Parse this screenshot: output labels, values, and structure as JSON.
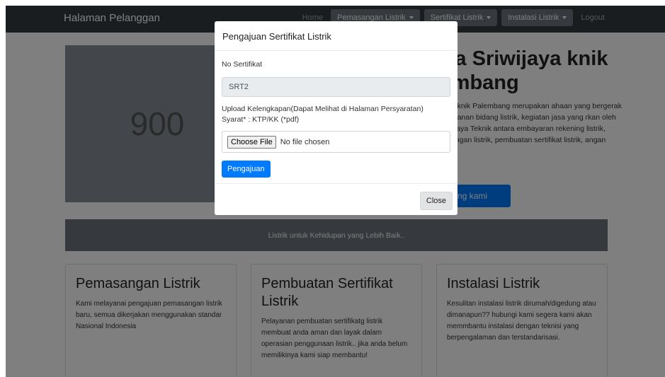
{
  "navbar": {
    "brand": "Halaman Pelanggan",
    "home": "Home",
    "menu_pemasangan": "Pemasangan Listrik",
    "menu_sertifikat": "Sertifikat Listrik",
    "menu_instalasi": "Instalasi Listrik",
    "logout": "Logout"
  },
  "hero": {
    "image_text": "900",
    "title": ". Duta Sriwijaya knik Palembang",
    "text": "ta Sriwijaya Teknik Palembang merupakan ahaan yang bergerak dibidang pelayanan bidang listrik, kegiatan jasa yang rkan oleh PT Duta Sriwijaya Teknik antara embayaran rekening listrik, pendaftaran angan listrik, pembuatan sertifikat listrik, angan instalasi listrik",
    "button": "tang kami"
  },
  "banner": {
    "text": "Listrik untuk Kehidupan yang Lebih Baik.."
  },
  "cards": [
    {
      "title": "Pemasangan Listrik",
      "text": "Kami melayanai pengajuan pemasangan listrik baru, semua dikerjakan menggunakan standar Nasional Indonesia"
    },
    {
      "title": "Pembuatan Sertifikat Listrik",
      "text": "Pelayanan pembuatan sertifikatg listrik membuat anda aman dan layak dalam operasian penggunaan listrik.. jika anda belum memilikinya kami siap membantu!"
    },
    {
      "title": "Instalasi Listrik",
      "text": "Kesulitan instalasi listrik dirumah/digedung atau dimanapun?? hubungi kami segera kami akan memmbantu instalasi dengan teknisi yang berpengalaman dan terstandarisasi."
    }
  ],
  "modal": {
    "title": "Pengajuan Sertifikat Listrik",
    "no_label": "No Sertifikat",
    "no_value": "SRT2",
    "upload_label": "Upload Kelengkapan(Dapat Melihat di Halaman Persyaratan)",
    "upload_hint": "Syarat* : KTP/KK (*pdf)",
    "file_button": "Choose File",
    "file_status": "No file chosen",
    "submit": "Pengajuan",
    "close": "Close"
  }
}
